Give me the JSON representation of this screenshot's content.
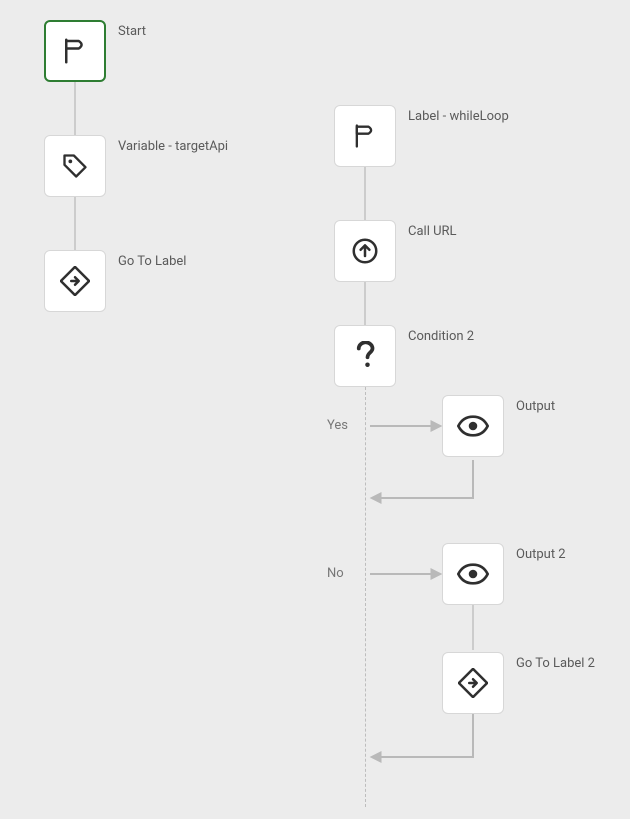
{
  "nodes": {
    "start": {
      "label": "Start",
      "icon": "flag-icon"
    },
    "variable": {
      "label": "Variable - targetApi",
      "icon": "tag-icon"
    },
    "goto": {
      "label": "Go To Label",
      "icon": "goto-icon"
    },
    "label_while": {
      "label": "Label - whileLoop",
      "icon": "flag-icon"
    },
    "call_url": {
      "label": "Call URL",
      "icon": "upload-icon"
    },
    "condition": {
      "label": "Condition 2",
      "icon": "question-icon"
    },
    "output_yes": {
      "label": "Output",
      "icon": "eye-icon"
    },
    "output_no": {
      "label": "Output 2",
      "icon": "eye-icon"
    },
    "goto2": {
      "label": "Go To Label 2",
      "icon": "goto-icon"
    }
  },
  "branches": {
    "yes": "Yes",
    "no": "No"
  }
}
